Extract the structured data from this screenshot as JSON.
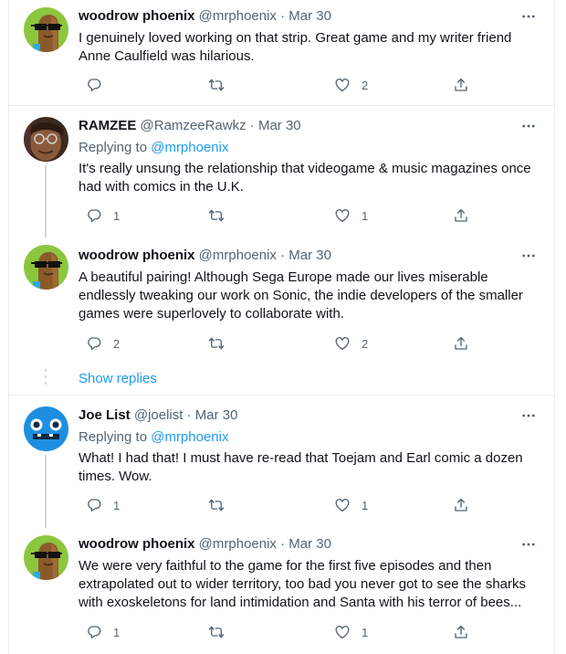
{
  "tweets": [
    {
      "name": "woodrow phoenix",
      "handle": "@mrphoenix",
      "time": "Mar 30",
      "replying_label": "",
      "replying_to": "",
      "text": "I genuinely loved working on that strip. Great game and my writer friend\nAnne Caulfield was hilarious.",
      "reply_count": "",
      "like_count": "2",
      "avatar": "cartoon-character-sunglasses"
    },
    {
      "name": "RAMZEE",
      "handle": "@RamzeeRawkz",
      "time": "Mar 30",
      "replying_label": "Replying to",
      "replying_to": "@mrphoenix",
      "text": "It's really unsung the relationship that videogame & music magazines once\nhad with comics in the U.K.",
      "reply_count": "1",
      "like_count": "1",
      "avatar": "photo-man-glasses"
    },
    {
      "name": "woodrow phoenix",
      "handle": "@mrphoenix",
      "time": "Mar 30",
      "replying_label": "",
      "replying_to": "",
      "text": "A beautiful pairing! Although Sega Europe made our lives miserable\nendlessly tweaking our work on Sonic, the indie developers of the smaller\ngames were superlovely to collaborate with.",
      "reply_count": "2",
      "like_count": "2",
      "avatar": "cartoon-character-sunglasses"
    },
    {
      "name": "Joe List",
      "handle": "@joelist",
      "time": "Mar 30",
      "replying_label": "Replying to",
      "replying_to": "@mrphoenix",
      "text": "What! I had that! I must have re-read that Toejam and Earl comic a dozen\ntimes. Wow.",
      "reply_count": "1",
      "like_count": "1",
      "avatar": "blue-robot-face"
    },
    {
      "name": "woodrow phoenix",
      "handle": "@mrphoenix",
      "time": "Mar 30",
      "replying_label": "",
      "replying_to": "",
      "text": "We were very faithful to the game for the first five episodes and then\nextrapolated out to wider territory, too bad you never got to see the sharks\nwith exoskeletons for land intimidation and Santa with his terror of bees...",
      "reply_count": "1",
      "like_count": "1",
      "avatar": "cartoon-character-sunglasses"
    }
  ],
  "show_replies_label": "Show replies",
  "separator": "·",
  "colors": {
    "link": "#1d9bf0",
    "muted": "#536471",
    "text": "#0f1419",
    "border": "#ebeef0"
  }
}
